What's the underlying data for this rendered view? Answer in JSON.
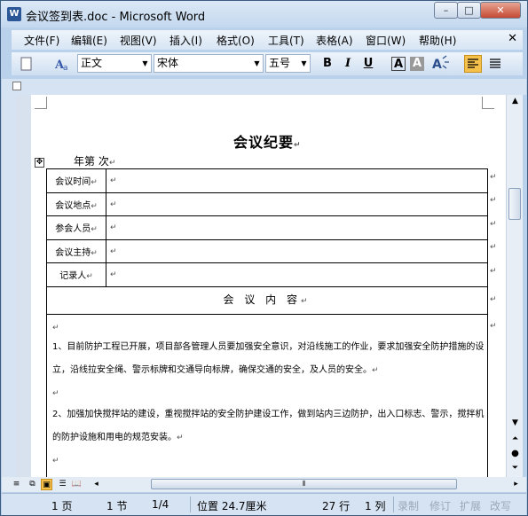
{
  "window": {
    "title": "会议签到表.doc - Microsoft Word",
    "min": "–",
    "max": "□",
    "close": "✕",
    "app_icon": "W"
  },
  "menu": [
    "文件(F)",
    "编辑(E)",
    "视图(V)",
    "插入(I)",
    "格式(O)",
    "工具(T)",
    "表格(A)",
    "窗口(W)",
    "帮助(H)"
  ],
  "toolbar": {
    "style": "正文",
    "font": "宋体",
    "size": "五号",
    "bold": "B",
    "italic": "I",
    "underline": "U",
    "charborder": "A",
    "charshade": "A"
  },
  "document": {
    "title": "会议纪要",
    "year_line": "年第    次",
    "rows": [
      {
        "label": "会议时间"
      },
      {
        "label": "会议地点"
      },
      {
        "label": "参会人员"
      },
      {
        "label": "会议主持"
      },
      {
        "label": "记录人"
      }
    ],
    "content_header": "会 议 内 容",
    "para1": "1、目前防护工程已开展，项目部各管理人员要加强安全意识，对沿线施工的作业，要求加强安全防护措施的设立，沿线拉安全绳、警示标牌和交通导向标牌，确保交通的安全，及人员的安全。",
    "para2": "2、加强加快搅拌站的建设，重视搅拌站的安全防护建设工作，做到站内三边防护，出入口标志、警示，搅拌机的防护设施和用电的规范安装。"
  },
  "status": {
    "page": "1 页",
    "section": "1 节",
    "pages": "1/4",
    "position": "位置 24.7厘米",
    "line": "27 行",
    "column": "1 列",
    "rec": "录制",
    "trk": "修订",
    "ext": "扩展",
    "ovr": "改写"
  }
}
